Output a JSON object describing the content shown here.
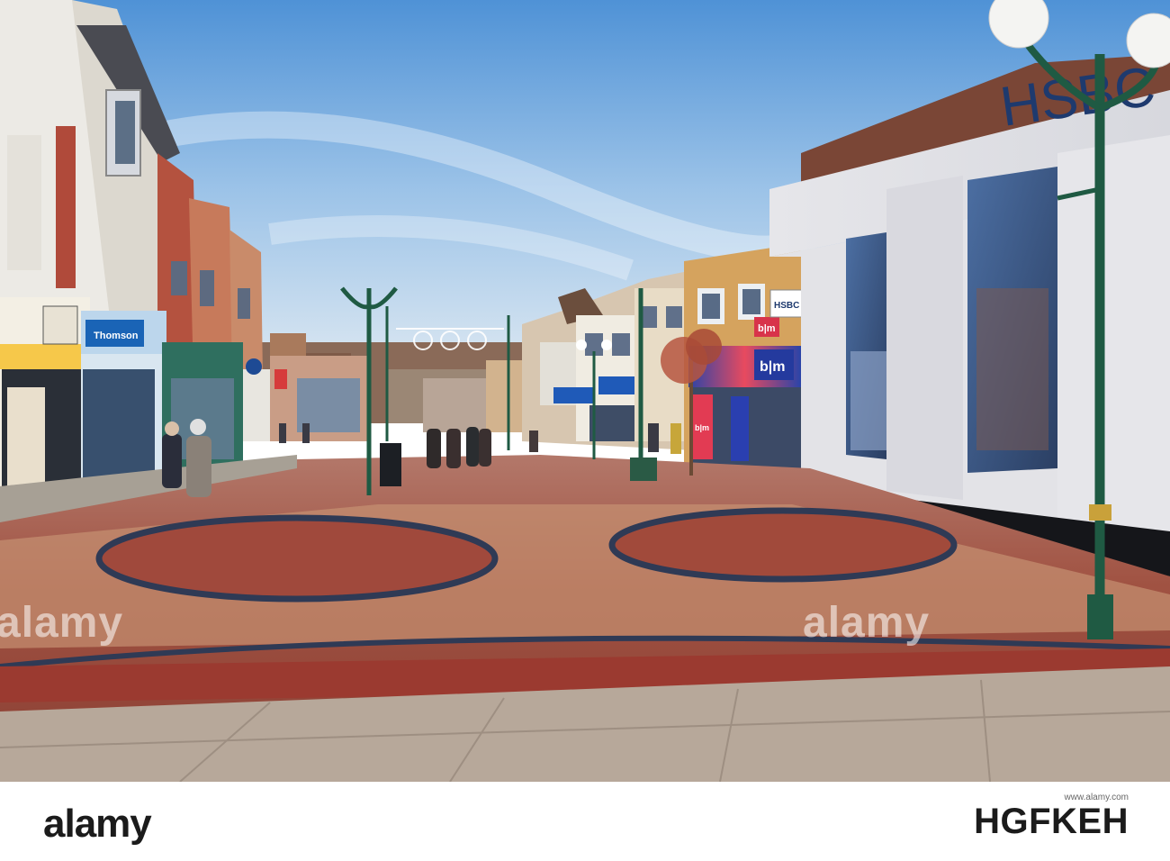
{
  "scene": {
    "description_hidden": "",
    "signs": {
      "hsbc_main": "HSBC",
      "hsbc_hanging": "HSBC",
      "thomson": "Thomson",
      "bm_small": "b|m",
      "bm_large": "b|m",
      "bm_vertical": "b|m",
      "costa_like": ""
    }
  },
  "watermarks": {
    "left": "alamy",
    "center": "alamy",
    "right": "alamy"
  },
  "footer": {
    "logo": "alamy",
    "image_id": "HGFKEH",
    "url": "www.alamy.com"
  },
  "colors": {
    "sky_top": "#4f92d6",
    "sky_bottom": "#e8eef3",
    "brick_red": "#9c3e32",
    "paving_tan": "#c08a5b",
    "lamp_green": "#1f5a43",
    "hsbc_blue": "#1e3a6e"
  }
}
